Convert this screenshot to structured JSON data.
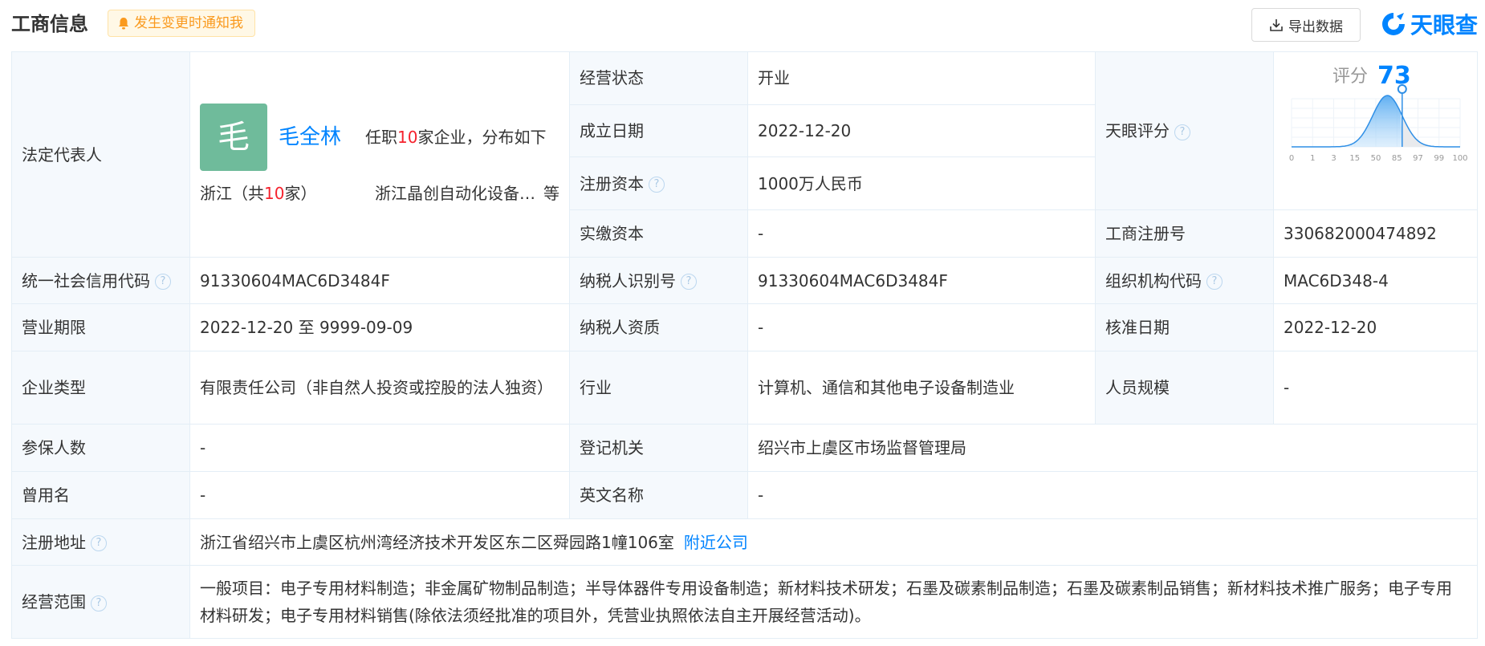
{
  "header": {
    "title": "工商信息",
    "notify_label": "发生变更时通知我",
    "export_label": "导出数据",
    "logo_text": "天眼查"
  },
  "legal_rep": {
    "label": "法定代表人",
    "avatar_char": "毛",
    "name": "毛全林",
    "position_prefix": "任职",
    "position_count": "10",
    "position_suffix": "家企业，分布如下",
    "region_prefix": "浙江（共",
    "region_count": "10",
    "region_suffix": "家）",
    "company": "浙江晶创自动化设备…",
    "etc": "等"
  },
  "rows": {
    "status_label": "经营状态",
    "status_value": "开业",
    "established_label": "成立日期",
    "established_value": "2022-12-20",
    "reg_capital_label": "注册资本",
    "reg_capital_value": "1000万人民币",
    "paid_capital_label": "实缴资本",
    "paid_capital_value": "-",
    "tianyan_score_label": "天眼评分",
    "reg_no_label": "工商注册号",
    "reg_no_value": "330682000474892",
    "credit_code_label": "统一社会信用代码",
    "credit_code_value": "91330604MAC6D3484F",
    "taxpayer_id_label": "纳税人识别号",
    "taxpayer_id_value": "91330604MAC6D3484F",
    "org_code_label": "组织机构代码",
    "org_code_value": "MAC6D348-4",
    "term_label": "营业期限",
    "term_value": "2022-12-20 至 9999-09-09",
    "taxpayer_qual_label": "纳税人资质",
    "taxpayer_qual_value": "-",
    "approval_label": "核准日期",
    "approval_value": "2022-12-20",
    "type_label": "企业类型",
    "type_value": "有限责任公司（非自然人投资或控股的法人独资）",
    "industry_label": "行业",
    "industry_value": "计算机、通信和其他电子设备制造业",
    "staff_label": "人员规模",
    "staff_value": "-",
    "insured_label": "参保人数",
    "insured_value": "-",
    "authority_label": "登记机关",
    "authority_value": "绍兴市上虞区市场监督管理局",
    "former_name_label": "曾用名",
    "former_name_value": "-",
    "english_name_label": "英文名称",
    "english_name_value": "-",
    "address_label": "注册地址",
    "address_value": "浙江省绍兴市上虞区杭州湾经济技术开发区东二区舜园路1幢106室",
    "nearby_link": "附近公司",
    "scope_label": "经营范围",
    "scope_value": "一般项目：电子专用材料制造；非金属矿物制品制造；半导体器件专用设备制造；新材料技术研发；石墨及碳素制品制造；石墨及碳素制品销售；新材料技术推广服务；电子专用材料研发；电子专用材料销售(除依法须经批准的项目外，凭营业执照依法自主开展经营活动)。"
  },
  "score": {
    "title": "评分",
    "value": 73,
    "axis_ticks": [
      "0",
      "1",
      "3",
      "15",
      "50",
      "85",
      "97",
      "99",
      "100"
    ]
  },
  "colors": {
    "accent": "#0084ff",
    "highlight": "#f5222d",
    "label_bg": "#f5f9fd",
    "notify_bg": "#fff8e6",
    "notify_text": "#fa9a1e"
  }
}
